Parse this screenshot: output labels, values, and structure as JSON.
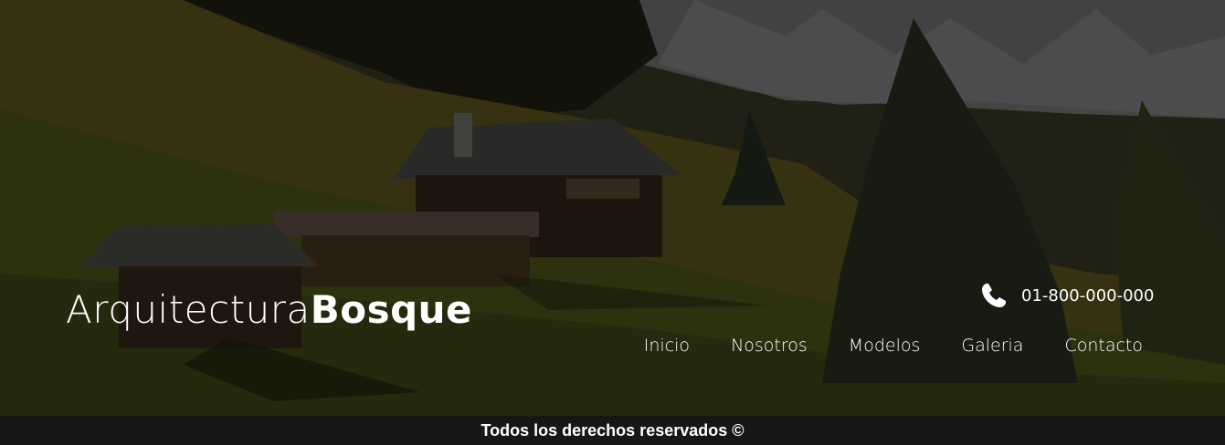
{
  "brand": {
    "name_light": "Arquitectura",
    "name_bold": "Bosque"
  },
  "contact": {
    "icon": "phone-icon",
    "phone": "01-800-000-000"
  },
  "nav": {
    "items": [
      {
        "label": "Inicio"
      },
      {
        "label": "Nosotros"
      },
      {
        "label": "Modelos"
      },
      {
        "label": "Galeria"
      },
      {
        "label": "Contacto"
      }
    ]
  },
  "footer": {
    "text": "Todos los derechos reservados ©"
  },
  "colors": {
    "text": "#ffffff",
    "footer_bg": "#171717"
  }
}
